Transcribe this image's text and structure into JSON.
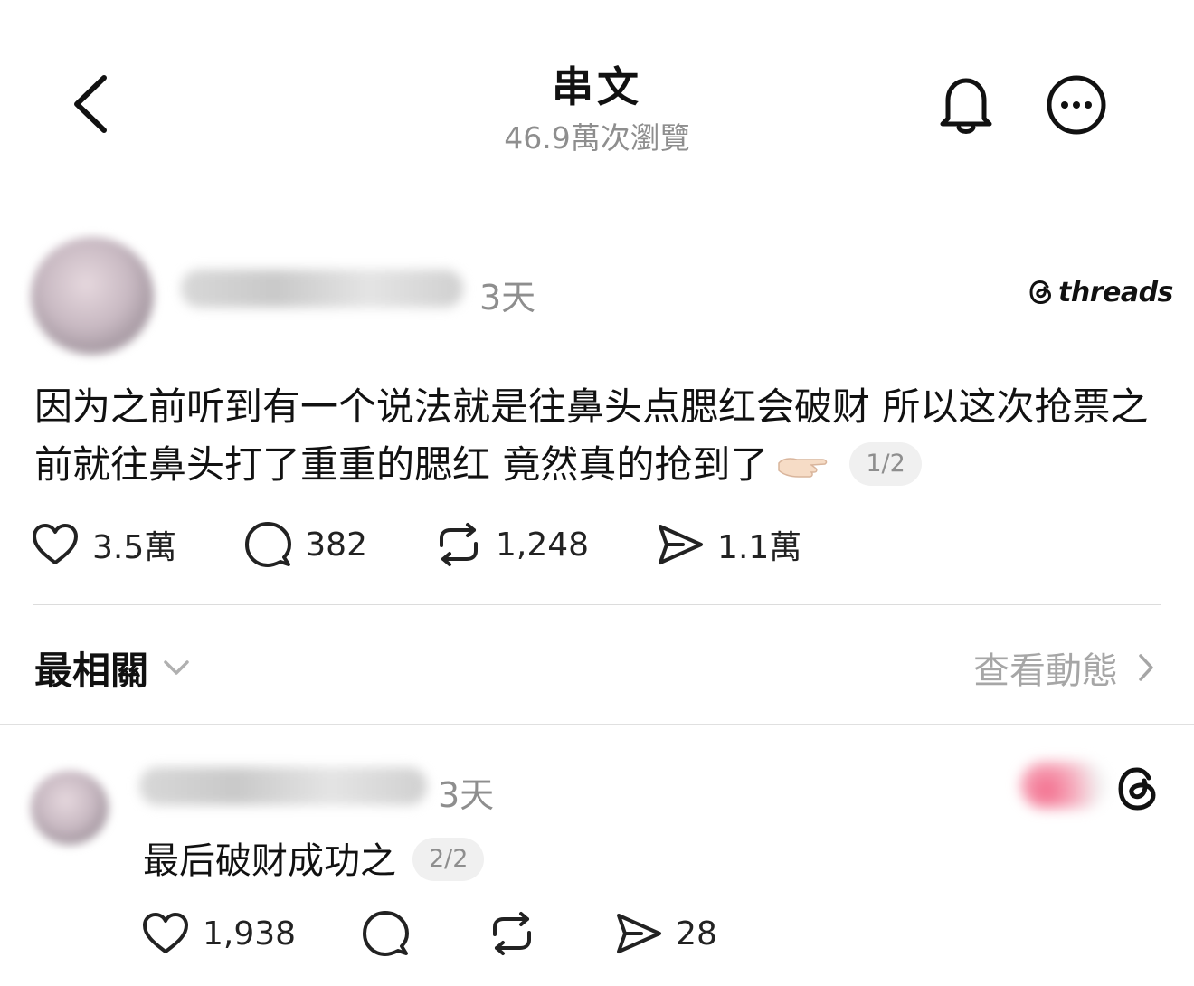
{
  "header": {
    "title": "串文",
    "views": "46.9萬次瀏覽",
    "back_icon": "chevron-left-icon",
    "bell_icon": "bell-icon",
    "more_icon": "more-circle-icon"
  },
  "post": {
    "time": "3天",
    "brand": "threads",
    "text": "因为之前听到有一个说法就是往鼻头点腮红会破财 所以这次抢票之前就往鼻头打了重重的腮红 竟然真的抢到了",
    "page": "1/2",
    "actions": {
      "likes": "3.5萬",
      "comments": "382",
      "reposts": "1,248",
      "shares": "1.1萬"
    }
  },
  "sort": {
    "label": "最相關",
    "activity": "查看動態"
  },
  "reply": {
    "time": "3天",
    "text": "最后破财成功之",
    "page": "2/2",
    "actions": {
      "likes": "1,938",
      "comments": "",
      "reposts": "",
      "shares": "28"
    }
  },
  "colors": {
    "text": "#111111",
    "secondary": "#8e8e8e",
    "divider": "#dcdcdc",
    "pill_bg": "#f0f0f0"
  }
}
